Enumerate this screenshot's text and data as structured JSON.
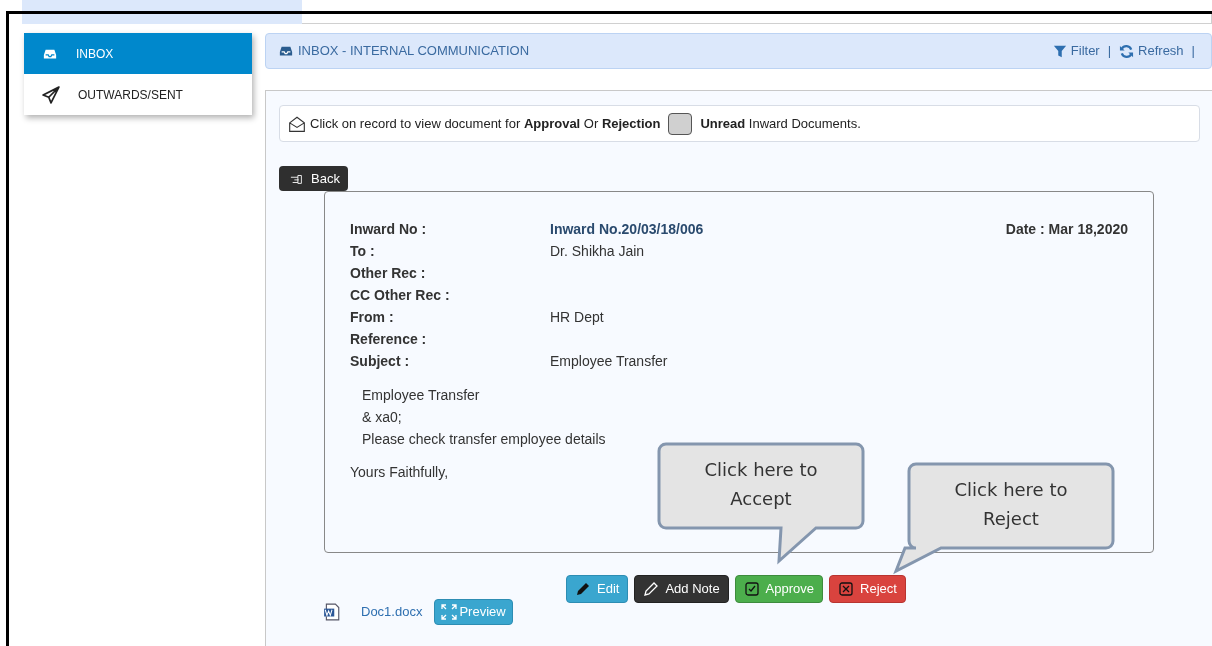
{
  "sidebar": {
    "items": [
      {
        "label": "INBOX",
        "selected": true
      },
      {
        "label": "OUTWARDS/SENT",
        "selected": false
      }
    ]
  },
  "header": {
    "title": "INBOX - INTERNAL COMMUNICATION",
    "actions": [
      {
        "label": "Filter"
      },
      {
        "label": "Refresh"
      }
    ],
    "separator": "|"
  },
  "notice": {
    "text": "Click on record to view document for **Approval** Or **Rejection**",
    "legend": "**Unread** Inward Documents."
  },
  "back_button": "Back",
  "document": {
    "date": "Date : Mar 18,2020",
    "fields": [
      {
        "label": "Inward No :",
        "value": "Inward No.20/03/18/006",
        "value_bold": true
      },
      {
        "label": "To :",
        "value": "Dr. Shikha Jain",
        "value_bold": false
      },
      {
        "label": "Other Rec :"
      },
      {
        "label": "CC Other Rec :"
      },
      {
        "label": "From :",
        "value": "HR Dept",
        "value_bold": false
      },
      {
        "label": "Reference :"
      },
      {
        "label": "Subject :",
        "value": "Employee Transfer",
        "value_bold": false
      }
    ],
    "body": [
      "Employee Transfer",
      "& xa0;",
      "Please check transfer employee details"
    ],
    "closing": "Yours Faithfully,"
  },
  "actions": [
    {
      "label": "Edit",
      "kind": "edit"
    },
    {
      "label": "Add Note",
      "kind": "note"
    },
    {
      "label": "Approve",
      "kind": "approve"
    },
    {
      "label": "Reject",
      "kind": "reject"
    }
  ],
  "attachment": {
    "name": "Doc1.docx",
    "preview": "Preview"
  },
  "callouts": [
    {
      "text": "Click here to Accept",
      "kind": "accept"
    },
    {
      "text": "Click here to Reject",
      "kind": "reject"
    }
  ]
}
